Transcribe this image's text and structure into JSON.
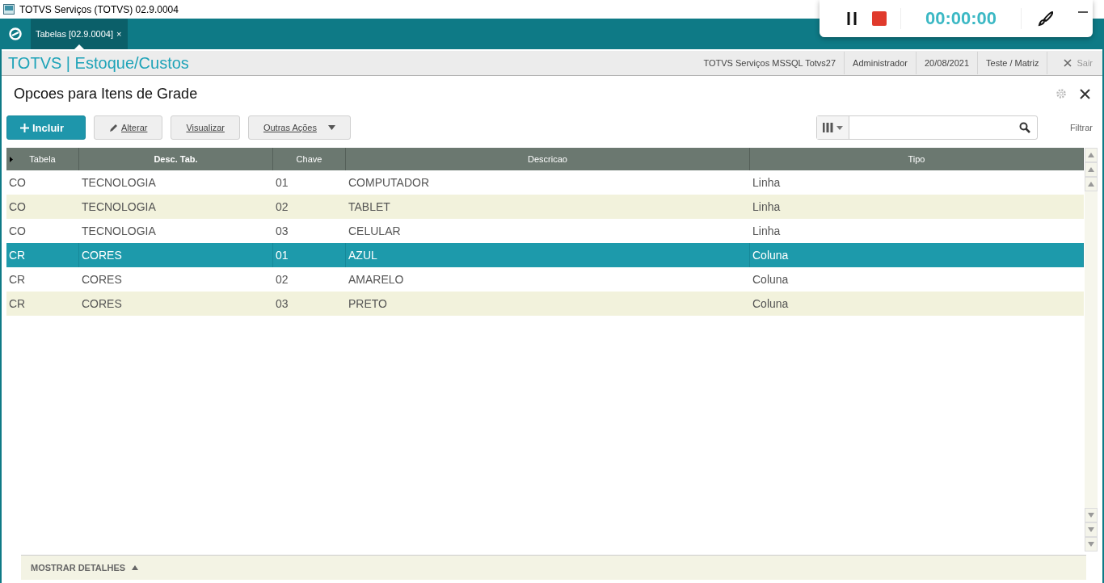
{
  "window": {
    "title": "TOTVS Serviços (TOTVS) 02.9.0004"
  },
  "tabs": [
    {
      "label": "Tabelas [02.9.0004]",
      "close": "×",
      "selected": true
    }
  ],
  "recorder": {
    "time": "00:00:00"
  },
  "header": {
    "brand": "TOTVS | Estoque/Custos",
    "info": [
      "TOTVS Serviços MSSQL Totvs27",
      "Administrador",
      "20/08/2021",
      "Teste / Matriz"
    ],
    "exit": "Sair"
  },
  "page": {
    "title": "Opcoes para Itens de Grade"
  },
  "toolbar": {
    "buttons": [
      {
        "label": "Incluir",
        "kind": "primary"
      },
      {
        "label": "Alterar",
        "kind": "edit"
      },
      {
        "label": "Visualizar",
        "kind": "plain"
      },
      {
        "label": "Outras Ações",
        "kind": "menu"
      }
    ],
    "filter": "Filtrar"
  },
  "table": {
    "columns": [
      "Tabela",
      "Desc. Tab.",
      "Chave",
      "Descricao",
      "Tipo"
    ],
    "rows": [
      {
        "cells": [
          "CO",
          "TECNOLOGIA",
          "01",
          "COMPUTADOR",
          "Linha"
        ],
        "selected": false
      },
      {
        "cells": [
          "CO",
          "TECNOLOGIA",
          "02",
          "TABLET",
          "Linha"
        ],
        "selected": false
      },
      {
        "cells": [
          "CO",
          "TECNOLOGIA",
          "03",
          "CELULAR",
          "Linha"
        ],
        "selected": false
      },
      {
        "cells": [
          "CR",
          "CORES",
          "01",
          "AZUL",
          "Coluna"
        ],
        "selected": true
      },
      {
        "cells": [
          "CR",
          "CORES",
          "02",
          "AMARELO",
          "Coluna"
        ],
        "selected": false
      },
      {
        "cells": [
          "CR",
          "CORES",
          "03",
          "PRETO",
          "Coluna"
        ],
        "selected": false
      }
    ]
  },
  "details": {
    "label": "MOSTRAR DETALHES"
  }
}
